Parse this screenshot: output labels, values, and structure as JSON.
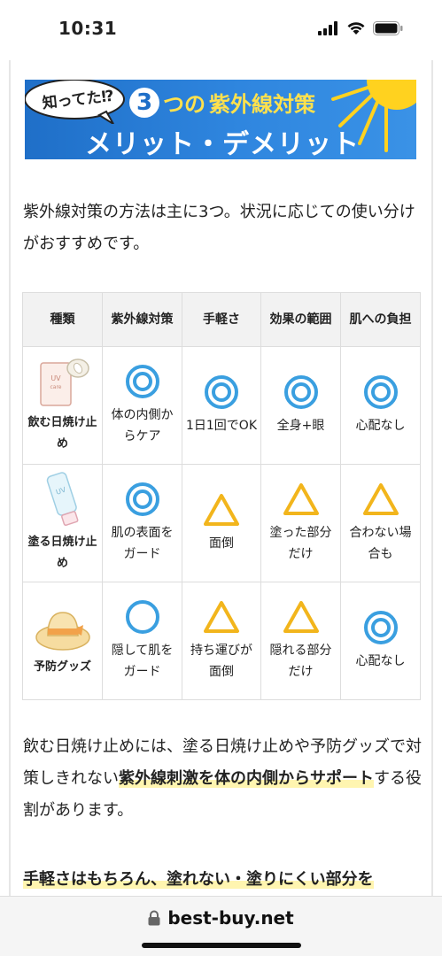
{
  "status_bar": {
    "time": "10:31"
  },
  "banner": {
    "bubble_text": "知ってた⁉",
    "number": "3",
    "line1_small": "つの",
    "line1": "紫外線対策",
    "line2": "メリット・デメリット"
  },
  "intro": {
    "text": "紫外線対策の方法は主に3つ。状況に応じての使い分けがおすすめです。"
  },
  "table": {
    "headers": [
      "種類",
      "紫外線対策",
      "手軽さ",
      "効果の範囲",
      "肌への負担"
    ],
    "rows": [
      {
        "type": "飲む日焼け止め",
        "type_image": "supplement-box-image",
        "cells": [
          {
            "mark": "double-circle",
            "text": "体の内側からケア"
          },
          {
            "mark": "double-circle",
            "text": "1日1回でOK"
          },
          {
            "mark": "double-circle",
            "text": "全身+眼"
          },
          {
            "mark": "double-circle",
            "text": "心配なし"
          }
        ]
      },
      {
        "type": "塗る日焼け止め",
        "type_image": "sunscreen-tube-image",
        "cells": [
          {
            "mark": "double-circle",
            "text": "肌の表面をガード"
          },
          {
            "mark": "triangle",
            "text": "面倒"
          },
          {
            "mark": "triangle",
            "text": "塗った部分だけ"
          },
          {
            "mark": "triangle",
            "text": "合わない場合も"
          }
        ]
      },
      {
        "type": "予防グッズ",
        "type_image": "sun-hat-image",
        "cells": [
          {
            "mark": "circle",
            "text": "隠して肌をガード"
          },
          {
            "mark": "triangle",
            "text": "持ち運びが面倒"
          },
          {
            "mark": "triangle",
            "text": "隠れる部分だけ"
          },
          {
            "mark": "double-circle",
            "text": "心配なし"
          }
        ]
      }
    ]
  },
  "para1": {
    "before": "飲む日焼け止めには、塗る日焼け止めや予防グッズで対策しきれない",
    "highlight": "紫外線刺激を体の内側からサポート",
    "after": "する役割があります。"
  },
  "para2": {
    "highlight": "手軽さはもちろん、塗れない・塗りにくい部分を"
  },
  "bottom_bar": {
    "url": "best-buy.net"
  },
  "colors": {
    "banner_blue": "#1f6fc8",
    "banner_yellow": "#ffe14d",
    "mark_blue": "#3a9fe0",
    "mark_yellow": "#f2b51c",
    "highlight": "#fff5b0"
  }
}
